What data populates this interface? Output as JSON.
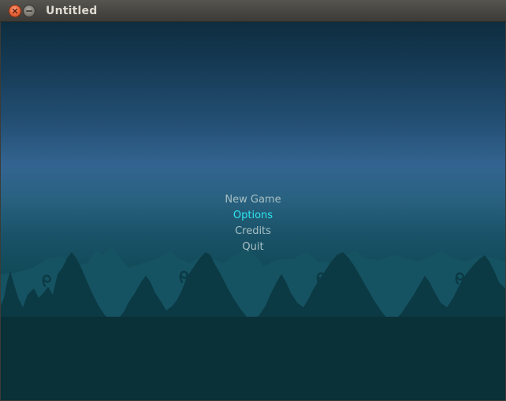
{
  "window": {
    "title": "Untitled",
    "close_icon": "close-icon",
    "minimize_icon": "minimize-icon"
  },
  "menu": {
    "items": [
      {
        "label": "New Game",
        "selected": false
      },
      {
        "label": "Options",
        "selected": true
      },
      {
        "label": "Credits",
        "selected": false
      },
      {
        "label": "Quit",
        "selected": false
      }
    ],
    "normal_color": "#a9c0c4",
    "selected_color": "#2ee6ee"
  },
  "scene": {
    "sky_top_color": "#0e2d3f",
    "sky_band_color": "#336491",
    "far_trees_color": "#165362",
    "near_trees_color": "#0b3a44",
    "ground_color": "#0a3038"
  }
}
